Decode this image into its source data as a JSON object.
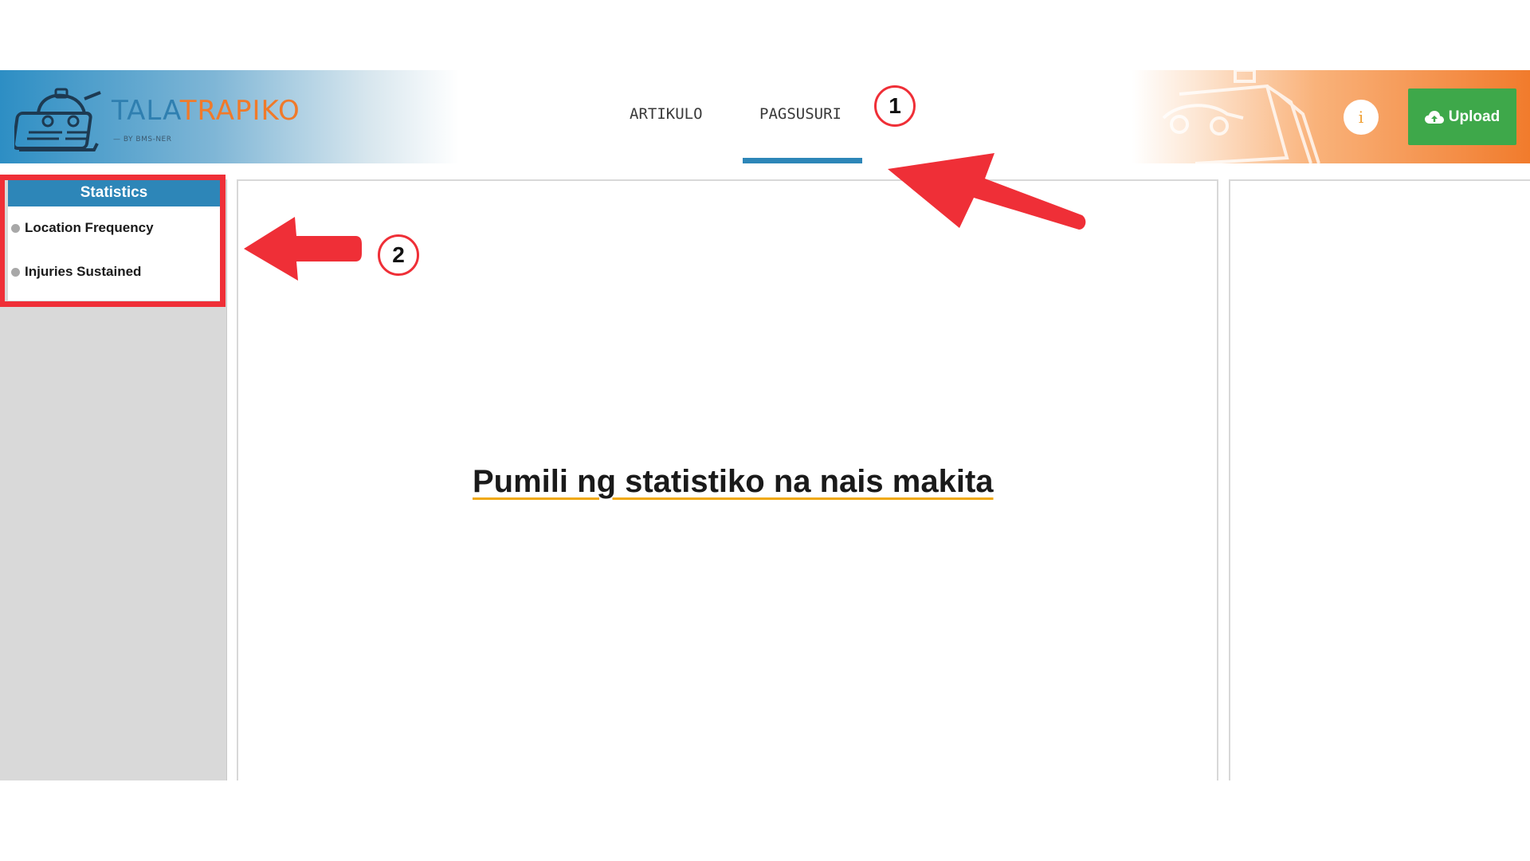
{
  "header": {
    "brand_part1": "TALA",
    "brand_part2": "TRAPIKO",
    "brand_sub": "BY BMS-NER",
    "nav_tabs": [
      {
        "label": "ARTIKULO",
        "active": false
      },
      {
        "label": "PAGSUSURI",
        "active": true
      }
    ],
    "info_label": "i",
    "upload_label": "Upload",
    "accent_color": "#2d86b8",
    "upload_color": "#3ea84a"
  },
  "sidebar": {
    "title": "Statistics",
    "items": [
      {
        "label": "Location Frequency"
      },
      {
        "label": "Injuries Sustained"
      }
    ]
  },
  "main": {
    "prompt": "Pumili ng statistiko na nais makita"
  },
  "annotations": {
    "marker_1": "1",
    "marker_2": "2",
    "color": "#ef2f37"
  }
}
